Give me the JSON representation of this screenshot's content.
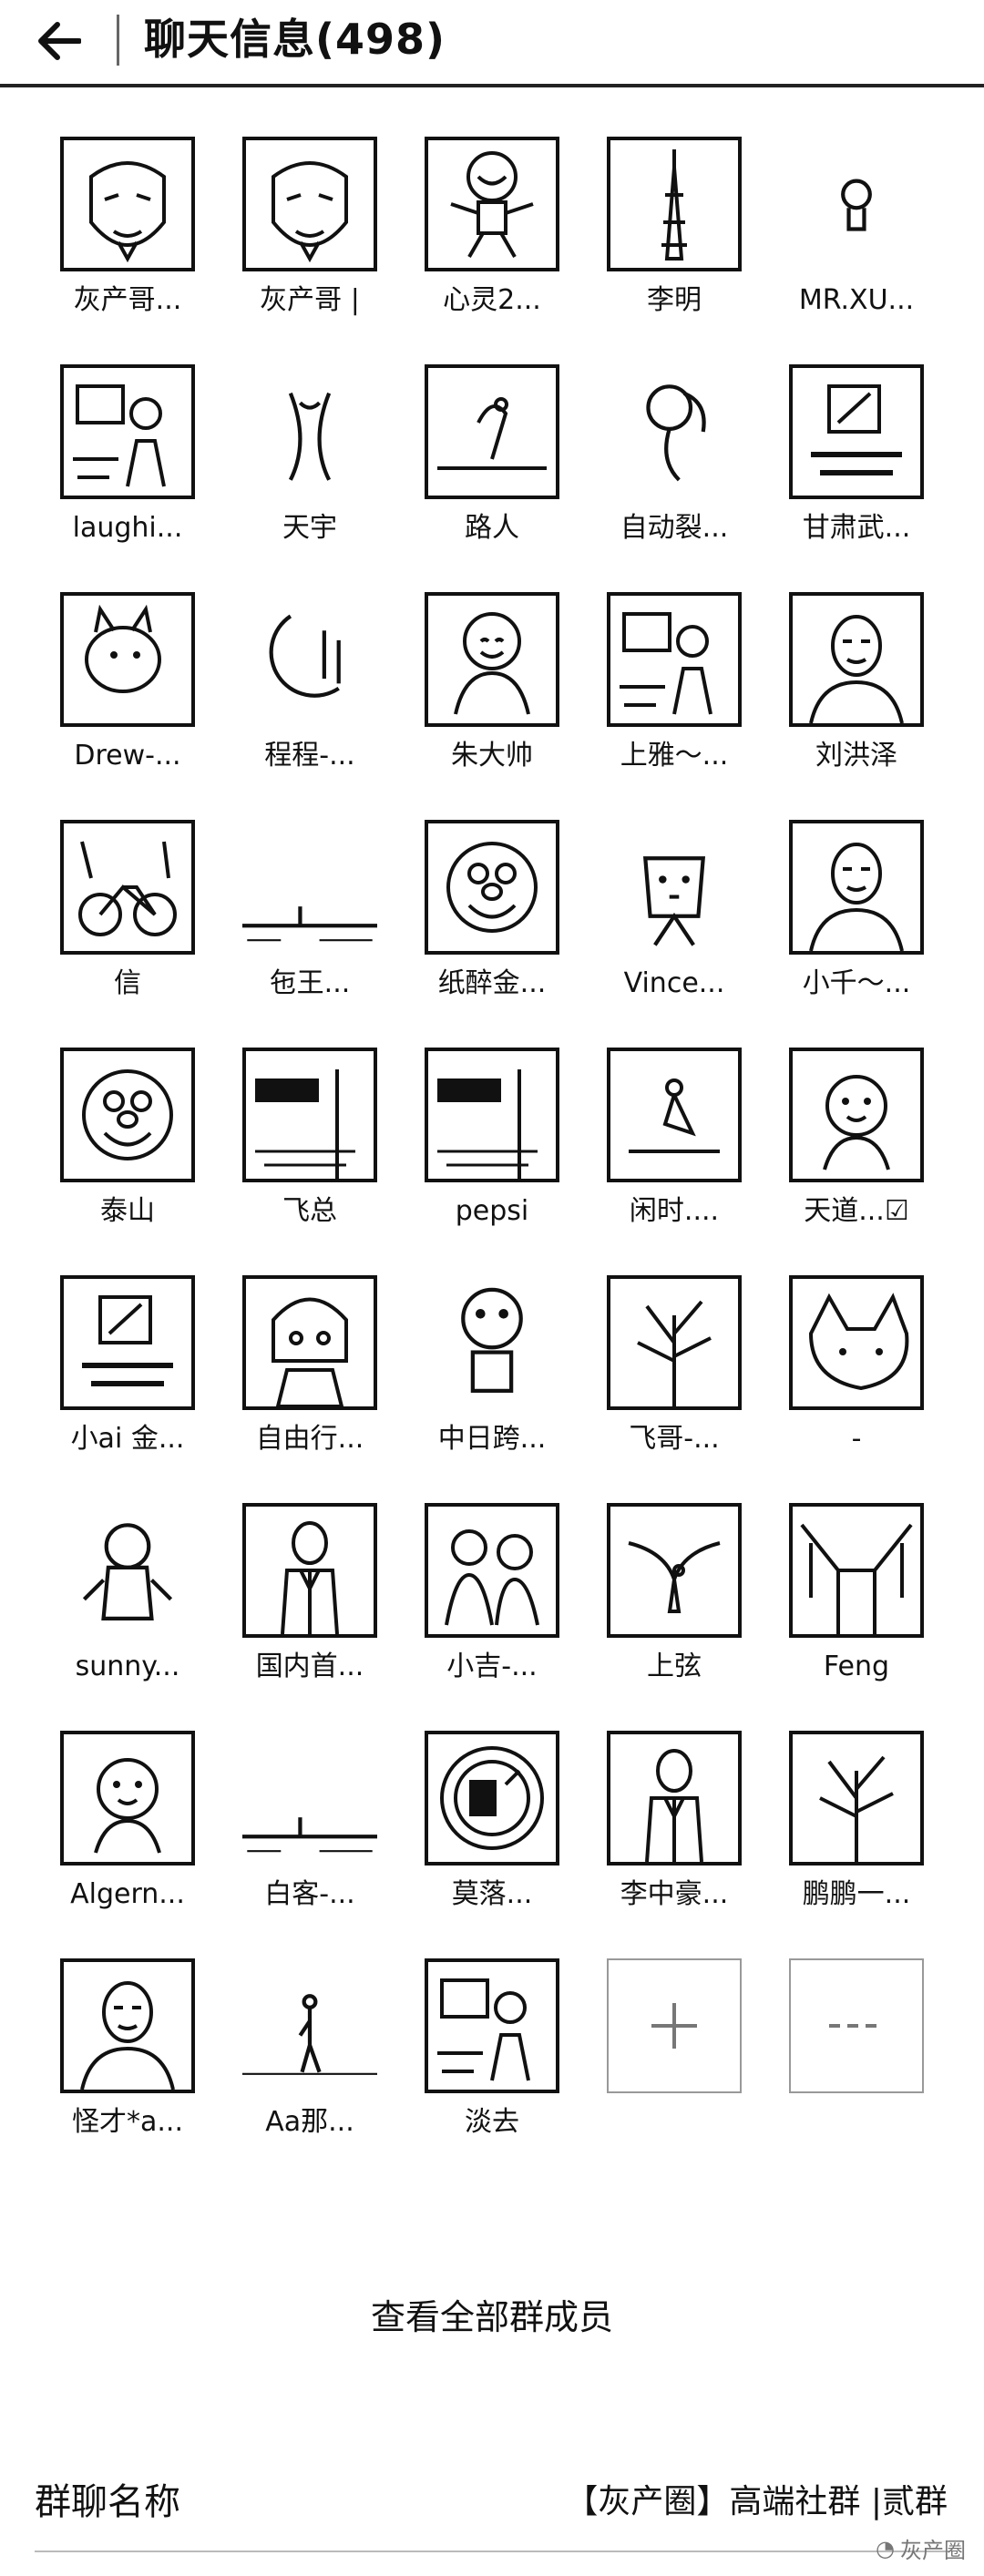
{
  "header": {
    "title": "聊天信息(498)"
  },
  "members": [
    {
      "name": "灰产哥...",
      "avatar": "mask-icon"
    },
    {
      "name": "灰产哥 |",
      "avatar": "mask-icon"
    },
    {
      "name": "心灵2...",
      "avatar": "cartoon-man-icon"
    },
    {
      "name": "李明",
      "avatar": "tower-icon"
    },
    {
      "name": "MR.XU...",
      "avatar": "small-figure-icon"
    },
    {
      "name": "laughi...",
      "avatar": "photo-icon"
    },
    {
      "name": "天宇",
      "avatar": "logo-icon"
    },
    {
      "name": "路人",
      "avatar": "penguin-icon"
    },
    {
      "name": "自动裂...",
      "avatar": "pin-icon"
    },
    {
      "name": "甘肃武...",
      "avatar": "calligraphy-icon"
    },
    {
      "name": "Drew-...",
      "avatar": "animal-icon"
    },
    {
      "name": "程程-...",
      "avatar": "moon-icon"
    },
    {
      "name": "朱大帅",
      "avatar": "buddha-icon"
    },
    {
      "name": "上雅～...",
      "avatar": "photo-icon"
    },
    {
      "name": "刘洪泽",
      "avatar": "portrait-icon"
    },
    {
      "name": "信",
      "avatar": "bicycle-icon"
    },
    {
      "name": "",
      "avatar": "landscape-icon"
    },
    {
      "name": "纸醉金...",
      "avatar": "cartoon-face-icon"
    },
    {
      "name": "Vince...",
      "avatar": "dog-icon"
    },
    {
      "name": "小千～...",
      "avatar": "portrait-icon"
    },
    {
      "name": "泰山",
      "avatar": "cartoon-face-icon"
    },
    {
      "name": "飞总",
      "avatar": "sign-icon"
    },
    {
      "name": "pepsi",
      "avatar": "sign-icon"
    },
    {
      "name": "闲时....",
      "avatar": "yoga-icon"
    },
    {
      "name": "天道...☑",
      "avatar": "baby-icon"
    },
    {
      "name": "小ai 金...",
      "avatar": "calligraphy-icon"
    },
    {
      "name": "自由行...",
      "avatar": "girl-icon"
    },
    {
      "name": "中日跨...",
      "avatar": "robot-icon"
    },
    {
      "name": "飞哥-...",
      "avatar": "tree-icon"
    },
    {
      "name": "-",
      "avatar": "cat-icon"
    },
    {
      "name": "sunny...",
      "avatar": "child-icon"
    },
    {
      "name": "国内首...",
      "avatar": "man-suit-icon"
    },
    {
      "name": "小吉-...",
      "avatar": "couple-icon"
    },
    {
      "name": "上弦",
      "avatar": "eagle-icon"
    },
    {
      "name": "Feng",
      "avatar": "street-icon"
    },
    {
      "name": "Algern...",
      "avatar": "baby-icon"
    },
    {
      "name": "白客-...",
      "avatar": "landscape-icon"
    },
    {
      "name": "莫落...",
      "avatar": "clock-icon"
    },
    {
      "name": "李中豪...",
      "avatar": "man-suit-icon"
    },
    {
      "name": "鹏鹏一...",
      "avatar": "tree-icon"
    },
    {
      "name": "怪才*a...",
      "avatar": "portrait-icon"
    },
    {
      "name": "Aa那...",
      "avatar": "walker-icon"
    },
    {
      "name": "淡去",
      "avatar": "photo-icon"
    }
  ],
  "member_prefixes": {
    "16": "王..."
  },
  "actions": {
    "add_icon": "plus-icon",
    "remove_icon": "minus-icon"
  },
  "view_all_label": "查看全部群成员",
  "group_name": {
    "label": "群聊名称",
    "value": "【灰产圈】高端社群 |贰群"
  },
  "watermark": "灰产圈"
}
